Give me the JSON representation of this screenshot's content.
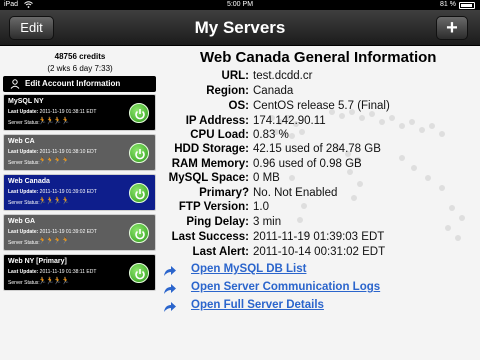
{
  "status_bar": {
    "carrier": "iPad",
    "time": "5:00 PM",
    "battery": "81 %"
  },
  "nav": {
    "title": "My Servers",
    "edit_label": "Edit",
    "add_label": "+"
  },
  "sidebar": {
    "credits": "48756 credits",
    "credits_time": "(2 wks 6 day 7:33)",
    "account_label": "Edit Account Information",
    "servers": [
      {
        "name": "MySQL NY",
        "update_label": "Last Update:",
        "update": "2011-11-19 01:38:11 EDT",
        "status_label": "Server Status:",
        "color": "#000000"
      },
      {
        "name": "Web CA",
        "update_label": "Last Update:",
        "update": "2011-11-19 01:38:10 EDT",
        "status_label": "Server Status:",
        "color": "#5e5e5e"
      },
      {
        "name": "Web Canada",
        "update_label": "Last Update:",
        "update": "2011-11-19 01:39:03 EDT",
        "status_label": "Server Status:",
        "color": "#0e1e8c"
      },
      {
        "name": "Web GA",
        "update_label": "Last Update:",
        "update": "2011-11-19 01:39:02 EDT",
        "status_label": "Server Status:",
        "color": "#5e5e5e"
      },
      {
        "name": "Web NY [Primary]",
        "update_label": "Last Update:",
        "update": "2011-11-19 01:38:11 EDT",
        "status_label": "Server Status:",
        "color": "#000000"
      }
    ]
  },
  "main": {
    "title": "Web Canada General Information",
    "fields": [
      {
        "label": "URL:",
        "value": "test.dcdd.cr"
      },
      {
        "label": "Region:",
        "value": "Canada"
      },
      {
        "label": "OS:",
        "value": "CentOS release 5.7 (Final)"
      },
      {
        "label": "IP Address:",
        "value": "174.142.90.11"
      },
      {
        "label": "CPU Load:",
        "value": "0.83 %"
      },
      {
        "label": "HDD Storage:",
        "value": "42.15 used of 284.78 GB"
      },
      {
        "label": "RAM Memory:",
        "value": "0.96 used of 0.98 GB"
      },
      {
        "label": "MySQL Space:",
        "value": "0 MB"
      },
      {
        "label": "Primary?",
        "value": "No. Not Enabled"
      },
      {
        "label": "FTP Version:",
        "value": "1.0"
      },
      {
        "label": "Ping Delay:",
        "value": "3 min"
      },
      {
        "label": "Last Success:",
        "value": "2011-11-19 01:39:03 EDT"
      },
      {
        "label": "Last Alert:",
        "value": "2011-10-14 00:31:02 EDT"
      }
    ],
    "links": [
      {
        "label": "Open MySQL DB List"
      },
      {
        "label": "Open Server Communication Logs"
      },
      {
        "label": "Open Full Server Details"
      }
    ]
  },
  "colors": {
    "link": "#2b65cc",
    "selected_server": "#0e1e8c",
    "power_green": "#2f9a1a"
  }
}
